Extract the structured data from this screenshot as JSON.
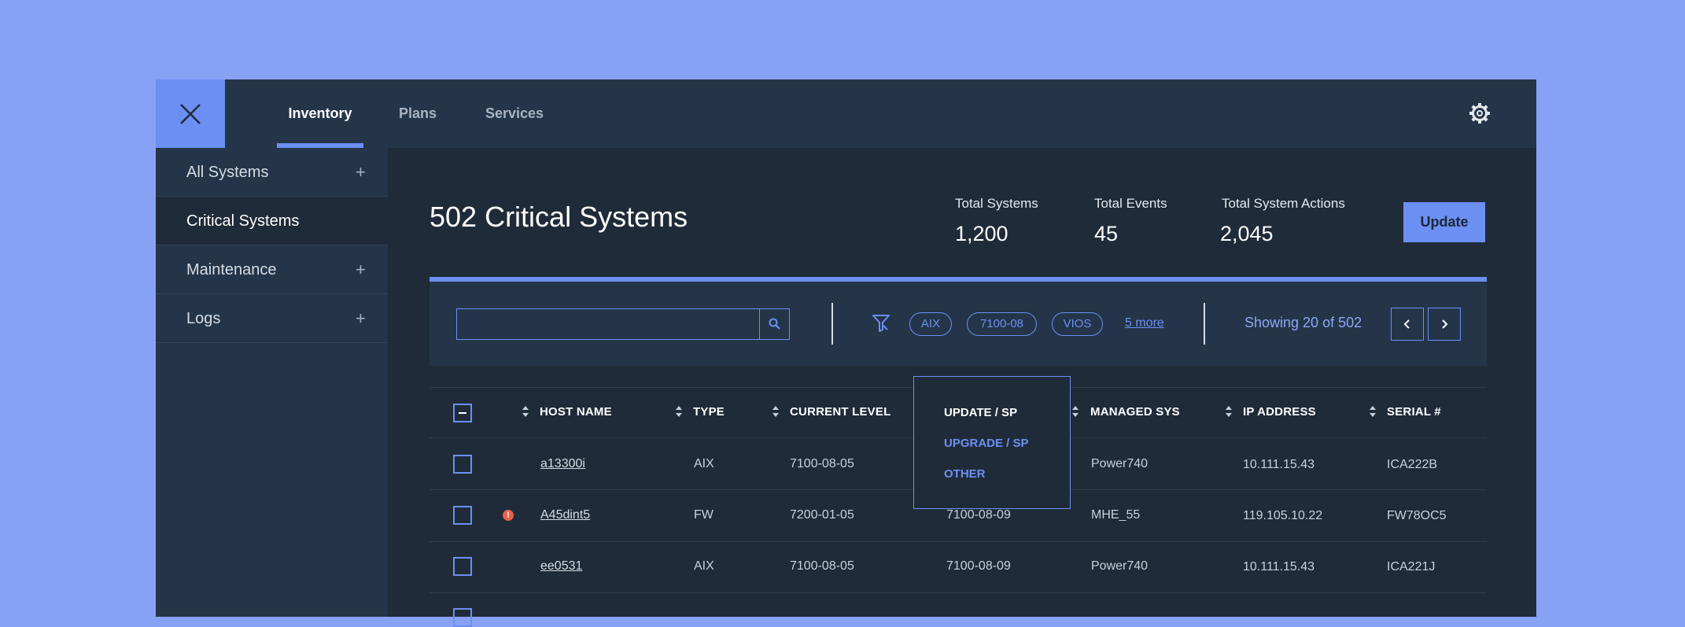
{
  "colors": {
    "background": "#87a2f5",
    "accent": "#6c8ff3",
    "panel": "#243549",
    "surface": "#1f2b38",
    "error": "#e8604c"
  },
  "topbar": {
    "close_icon": "close-icon",
    "tabs": [
      {
        "label": "Inventory",
        "active": true
      },
      {
        "label": "Plans",
        "active": false
      },
      {
        "label": "Services",
        "active": false
      }
    ],
    "settings_icon": "gear-icon"
  },
  "sidebar": {
    "items": [
      {
        "label": "All Systems",
        "expand": "+"
      },
      {
        "label": "Critical Systems",
        "expand": ""
      },
      {
        "label": "Maintenance",
        "expand": "+"
      },
      {
        "label": "Logs",
        "expand": "+"
      }
    ]
  },
  "main": {
    "title": "502 Critical Systems",
    "stats": [
      {
        "label": "Total Systems",
        "value": "1,200"
      },
      {
        "label": "Total Events",
        "value": "45"
      },
      {
        "label": "Total System Actions",
        "value": "2,045"
      }
    ],
    "update_label": "Update"
  },
  "filter": {
    "search_value": "",
    "search_icon": "search-icon",
    "filter_icon": "filter-icon",
    "pills": [
      "AIX",
      "7100-08",
      "VIOS"
    ],
    "more_label": "5 more",
    "showing": "Showing 20 of 502"
  },
  "table": {
    "headers": [
      "HOST NAME",
      "TYPE",
      "CURRENT LEVEL",
      "MANAGED SYS",
      "IP ADDRESS",
      "SERIAL #"
    ],
    "rows": [
      {
        "host": "a13300i",
        "error": false,
        "type": "AIX",
        "current": "7100-08-05",
        "update": "",
        "managed": "Power740",
        "ip": "10.111.15.43",
        "serial": "ICA222B"
      },
      {
        "host": "A45dint5",
        "error": true,
        "type": "FW",
        "current": "7200-01-05",
        "update": "7100-08-09",
        "managed": "MHE_55",
        "ip": "119.105.10.22",
        "serial": "FW78OC5"
      },
      {
        "host": "ee0531",
        "error": false,
        "type": "AIX",
        "current": "7100-08-05",
        "update": "7100-08-09",
        "managed": "Power740",
        "ip": "10.111.15.43",
        "serial": "ICA221J"
      }
    ]
  },
  "dropdown": {
    "items": [
      {
        "label": "UPDATE / SP",
        "selected": false
      },
      {
        "label": "UPGRADE / SP",
        "selected": true
      },
      {
        "label": "OTHER",
        "selected": false
      }
    ]
  }
}
